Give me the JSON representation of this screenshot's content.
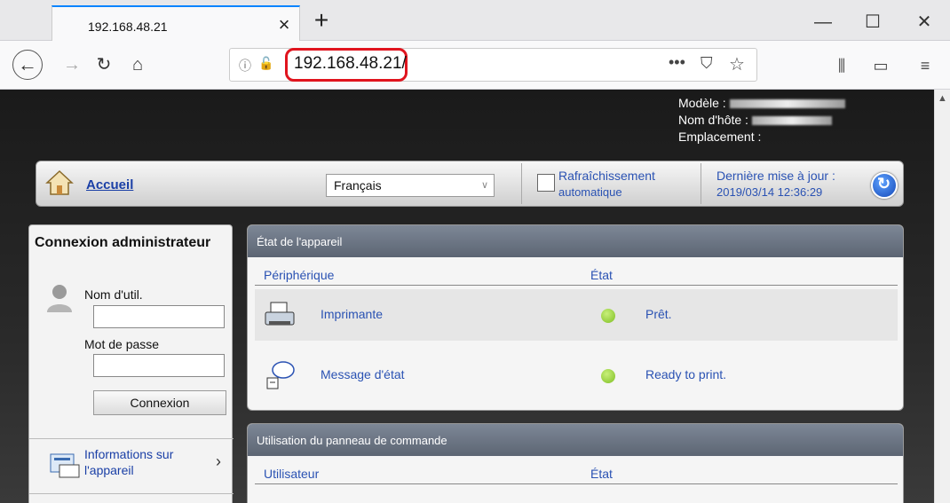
{
  "browser": {
    "tab_title": "192.168.48.21",
    "tab_close": "×",
    "new_tab": "+",
    "url": "192.168.48.21/",
    "url_more": "•••",
    "window_minimize": "—",
    "window_maximize": "☐",
    "window_close": "✕"
  },
  "header": {
    "model_label": "Modèle :",
    "host_label": "Nom d'hôte :",
    "location_label": "Emplacement :"
  },
  "topbar": {
    "home_link": "Accueil",
    "language": "Français",
    "refresh_line1": "Rafraîchissement",
    "refresh_line2": "automatique",
    "update_line1": "Dernière mise à jour :",
    "update_line2": "2019/03/14 12:36:29"
  },
  "sidebar": {
    "title": "Connexion administrateur",
    "username_label": "Nom d'util.",
    "password_label": "Mot de passe",
    "login_button": "Connexion",
    "info_line1": "Informations sur",
    "info_line2": "l'appareil"
  },
  "device_panel": {
    "title": "État de l'appareil",
    "col_device": "Périphérique",
    "col_status": "État",
    "rows": [
      {
        "name": "Imprimante",
        "status": "Prêt."
      },
      {
        "name": "Message d'état",
        "status": "Ready to print."
      }
    ]
  },
  "ops_panel": {
    "title": "Utilisation du panneau de commande",
    "col_user": "Utilisateur",
    "col_status": "État"
  },
  "colors": {
    "accent_tab": "#0a84ff",
    "url_highlight": "#e0141e",
    "link_blue": "#2a52b3",
    "status_green": "#7fbf24"
  }
}
